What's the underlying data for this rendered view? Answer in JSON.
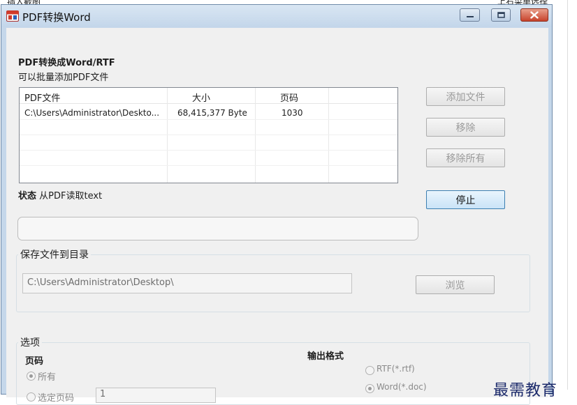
{
  "background_fragments": {
    "top_left": "插入截图",
    "top_right": "上右菜单选择"
  },
  "window": {
    "title": "PDF转换Word",
    "controls": {
      "minimize": "—",
      "maximize": "□",
      "close": "✕"
    }
  },
  "main": {
    "heading": "PDF转换成Word/RTF",
    "subtitle": "可以批量添加PDF文件",
    "list": {
      "columns": [
        "PDF文件",
        "大小",
        "页码"
      ],
      "rows": [
        {
          "file": "C:\\Users\\Administrator\\Deskto...",
          "size": "68,415,377 Byte",
          "pages": "1030"
        }
      ]
    },
    "buttons": {
      "add_file": "添加文件",
      "remove": "移除",
      "remove_all": "移除所有",
      "stop": "停止"
    },
    "status": {
      "label": "状态",
      "text": "从PDF读取text"
    },
    "progress": 0
  },
  "save_group": {
    "label": "保存文件到目录",
    "path": "C:\\Users\\Administrator\\Desktop\\",
    "browse": "浏览"
  },
  "options_group": {
    "label": "选项",
    "pages_label": "页码",
    "pages_all": "所有",
    "pages_range_label": "选定页码",
    "pages_range_value": "1",
    "output_label": "输出格式",
    "format_rtf": "RTF(*.rtf)",
    "format_doc": "Word(*.doc)"
  },
  "watermark": "最需教育",
  "colors": {
    "titlebar": "#c5d7ea",
    "close_button": "#c7432c",
    "client_bg": "#f0f0f0",
    "watermark": "#1c2a6b"
  },
  "icons": {
    "app": "pdf-to-word-app-icon",
    "minimize": "minimize-icon",
    "maximize": "maximize-icon",
    "close": "close-icon"
  }
}
